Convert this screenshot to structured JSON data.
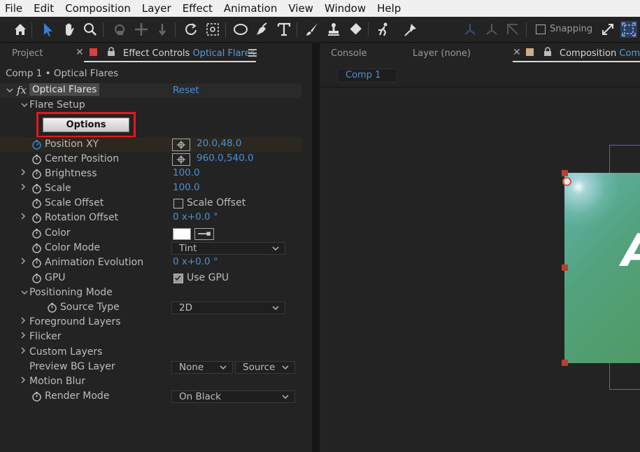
{
  "menu": [
    "File",
    "Edit",
    "Composition",
    "Layer",
    "Effect",
    "Animation",
    "View",
    "Window",
    "Help"
  ],
  "toolbar": {
    "tools": [
      "home-icon",
      "selection-tool-icon",
      "hand-tool-icon",
      "zoom-tool-icon",
      "orbit-camera-icon",
      "pan-camera-icon",
      "dolly-camera-icon",
      "rotation-tool-icon",
      "pan-behind-tool-icon",
      "ellipse-tool-icon",
      "pen-tool-icon",
      "type-tool-icon",
      "brush-tool-icon",
      "clone-stamp-icon",
      "eraser-tool-icon",
      "roto-brush-icon",
      "puppet-pin-icon"
    ],
    "snapping_label": "Snapping"
  },
  "left_panel": {
    "tabs": {
      "project": "Project",
      "effect_controls": "Effect Controls",
      "effect_controls_layer": "Optical Flares"
    },
    "title": "Comp 1 • Optical Flares",
    "effect": {
      "fx": "fx",
      "name": "Optical Flares",
      "reset": "Reset"
    },
    "flare_setup": "Flare Setup",
    "options_button": "Options",
    "properties": [
      {
        "label": "Position XY",
        "value": "20.0,48.0"
      },
      {
        "label": "Center Position",
        "value": "960.0,540.0"
      },
      {
        "label": "Brightness",
        "value": "100.0"
      },
      {
        "label": "Scale",
        "value": "100.0"
      },
      {
        "label": "Scale Offset",
        "value": "Scale Offset"
      },
      {
        "label": "Rotation Offset",
        "value": "0 x+0.0 °"
      },
      {
        "label": "Color",
        "value": ""
      },
      {
        "label": "Color Mode",
        "value": "Tint"
      },
      {
        "label": "Animation Evolution",
        "value": "0 x+0.0 °"
      },
      {
        "label": "GPU",
        "value": "Use GPU"
      }
    ],
    "positioning_mode": "Positioning Mode",
    "source_type": {
      "label": "Source Type",
      "value": "2D"
    },
    "groups": [
      "Foreground Layers",
      "Flicker",
      "Custom Layers"
    ],
    "preview_bg": {
      "label": "Preview BG Layer",
      "value1": "None",
      "value2": "Source"
    },
    "motion_blur": "Motion Blur",
    "render_mode": {
      "label": "Render Mode",
      "value": "On Black"
    },
    "colors": {
      "accent_blue": "#4c8fd6",
      "options_highlight": "#e5181e",
      "panel_bg": "#232323"
    }
  },
  "right_panel": {
    "tabs": {
      "console": "Console",
      "layer": "Layer (none)",
      "composition": "Composition",
      "composition_name": "Comp"
    },
    "subtab": "Comp 1",
    "viewer_text": "A"
  }
}
